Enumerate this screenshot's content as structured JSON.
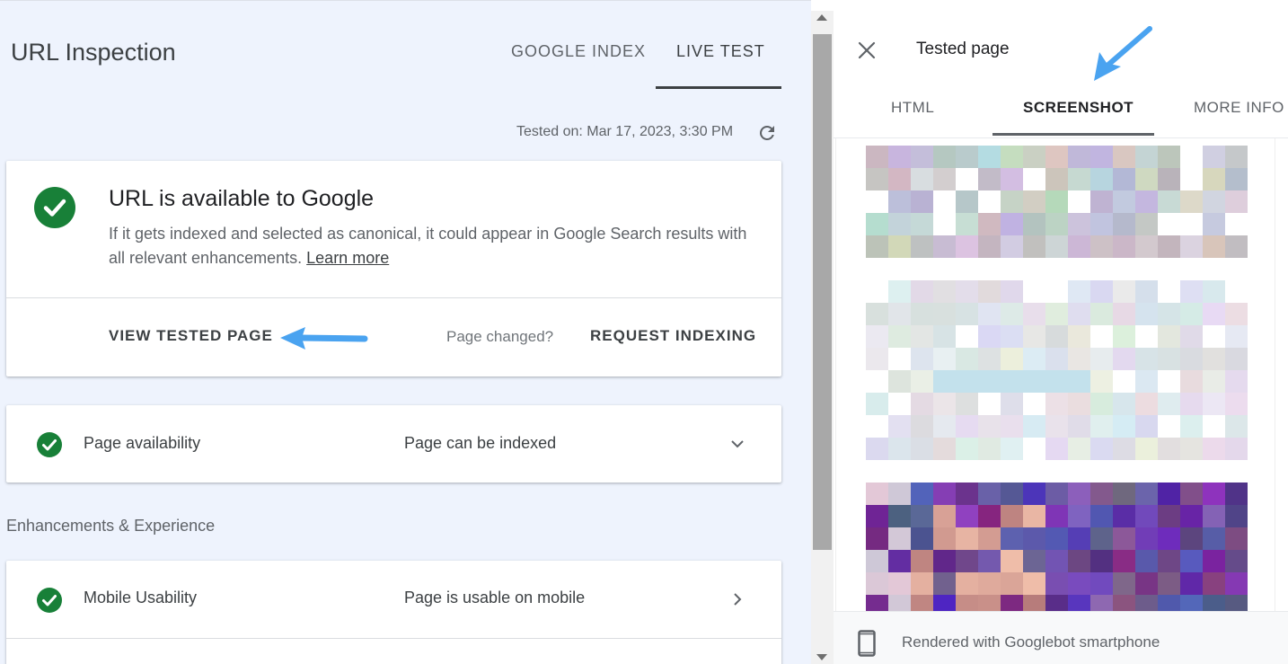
{
  "inspection": {
    "title": "URL Inspection",
    "tabs": [
      "GOOGLE INDEX",
      "LIVE TEST"
    ],
    "active_tab": "LIVE TEST",
    "tested_on": "Tested on: Mar 17, 2023, 3:30 PM"
  },
  "status_card": {
    "title": "URL is available to Google",
    "description": "If it gets indexed and selected as canonical, it could appear in Google Search results with all relevant enhancements.",
    "learn_more": "Learn more",
    "view_tested_page": "VIEW TESTED PAGE",
    "page_changed": "Page changed?",
    "request_indexing": "REQUEST INDEXING"
  },
  "availability": {
    "label": "Page availability",
    "value": "Page can be indexed"
  },
  "enhancements": {
    "heading": "Enhancements & Experience",
    "mobile_label": "Mobile Usability",
    "mobile_value": "Page is usable on mobile"
  },
  "tested_panel": {
    "title": "Tested page",
    "tabs": [
      "HTML",
      "SCREENSHOT",
      "MORE INFO"
    ],
    "active_tab": "SCREENSHOT",
    "footer": "Rendered with Googlebot smartphone"
  },
  "colors": {
    "success": "#188038",
    "arrow": "#4aa3f0",
    "background": "#eef3fd"
  },
  "icons": {
    "status": "check-circle-icon",
    "refresh": "refresh-icon",
    "expand": "chevron-down-icon",
    "open": "chevron-right-icon",
    "close": "close-icon",
    "device": "smartphone-icon"
  }
}
